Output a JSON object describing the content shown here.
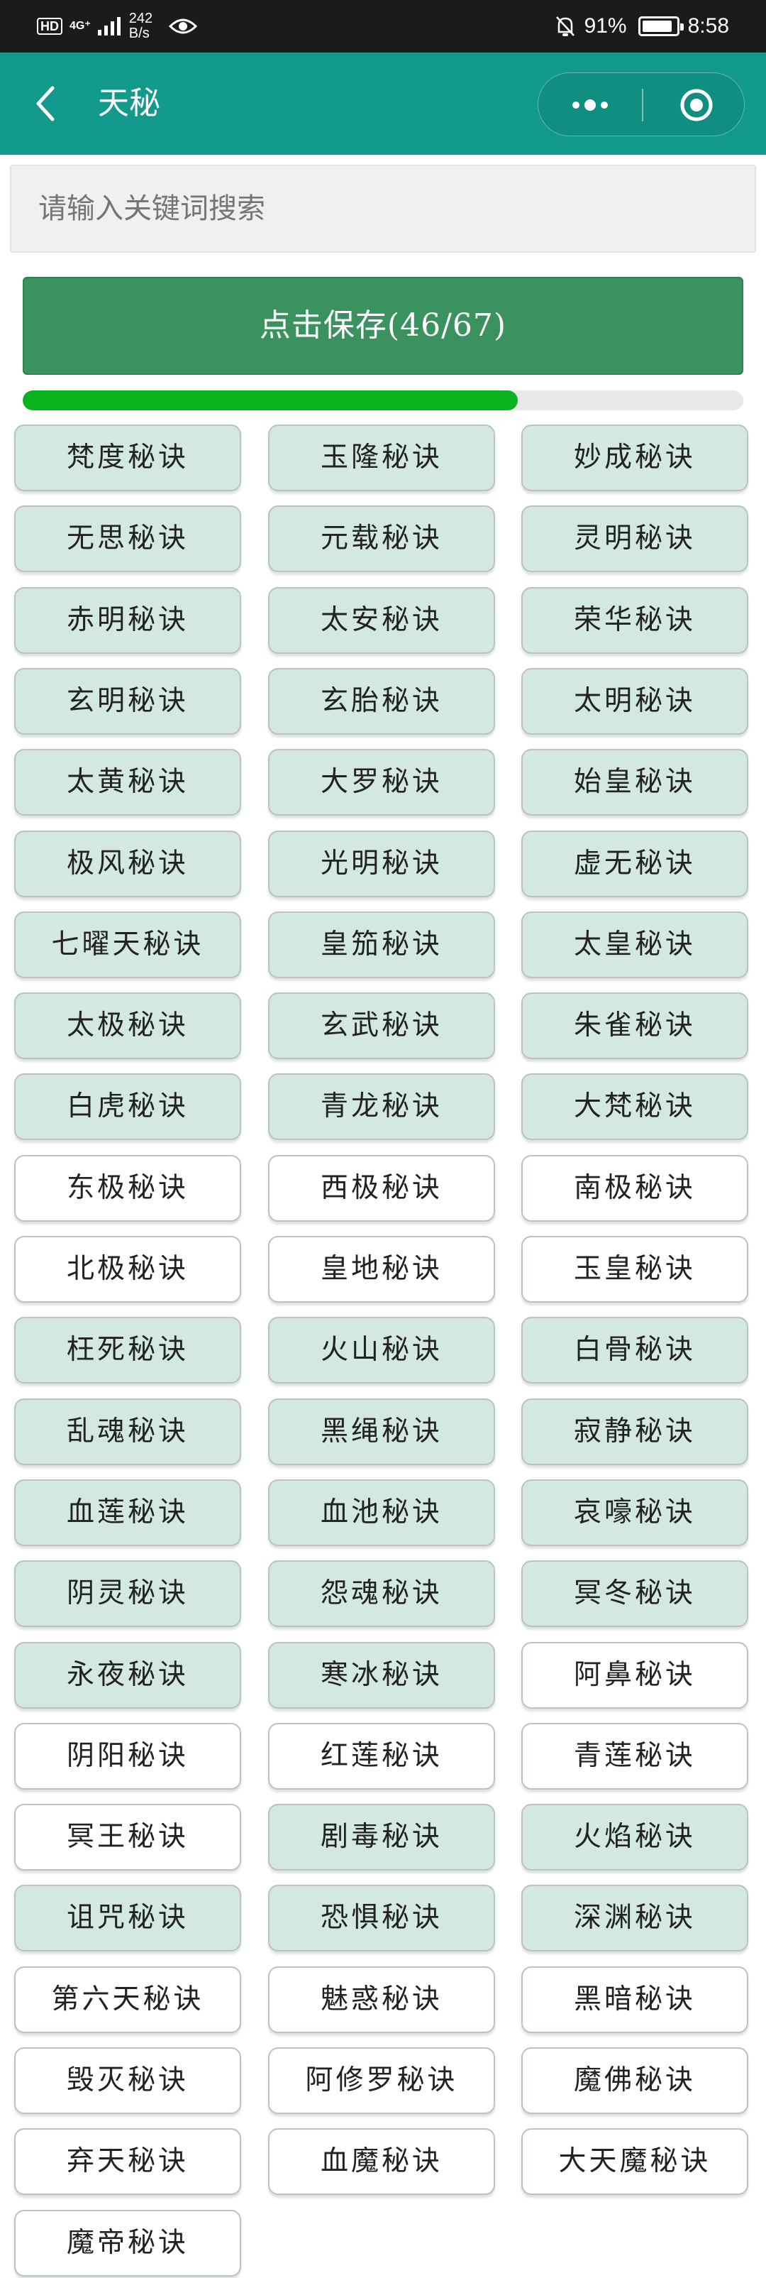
{
  "status_bar": {
    "hd": "HD",
    "network": "4G⁺",
    "speed_value": "242",
    "speed_unit": "B/s",
    "battery_text": "91%",
    "battery_level": 0.91,
    "time": "8:58"
  },
  "nav": {
    "title": "天秘",
    "back_icon": "chevron-left-icon",
    "more_icon": "more-dots-icon",
    "close_icon": "mini-program-close-icon"
  },
  "search": {
    "placeholder": "请输入关键词搜索",
    "value": ""
  },
  "save_button": {
    "label": "点击保存(46/67)"
  },
  "progress": {
    "saved": 46,
    "total": 67,
    "fraction": 0.6866
  },
  "colors": {
    "nav_bg": "#129b8d",
    "save_bg": "#3a925e",
    "progress_fill": "#09b31d",
    "saved_item_bg": "#d3e8df",
    "unsaved_item_bg": "#ffffff"
  },
  "items": [
    {
      "label": "梵度秘诀",
      "saved": true
    },
    {
      "label": "玉隆秘诀",
      "saved": true
    },
    {
      "label": "妙成秘诀",
      "saved": true
    },
    {
      "label": "无思秘诀",
      "saved": true
    },
    {
      "label": "元载秘诀",
      "saved": true
    },
    {
      "label": "灵明秘诀",
      "saved": true
    },
    {
      "label": "赤明秘诀",
      "saved": true
    },
    {
      "label": "太安秘诀",
      "saved": true
    },
    {
      "label": "荣华秘诀",
      "saved": true
    },
    {
      "label": "玄明秘诀",
      "saved": true
    },
    {
      "label": "玄胎秘诀",
      "saved": true
    },
    {
      "label": "太明秘诀",
      "saved": true
    },
    {
      "label": "太黄秘诀",
      "saved": true
    },
    {
      "label": "大罗秘诀",
      "saved": true
    },
    {
      "label": "始皇秘诀",
      "saved": true
    },
    {
      "label": "极风秘诀",
      "saved": true
    },
    {
      "label": "光明秘诀",
      "saved": true
    },
    {
      "label": "虚无秘诀",
      "saved": true
    },
    {
      "label": "七曜天秘诀",
      "saved": true
    },
    {
      "label": "皇笳秘诀",
      "saved": true
    },
    {
      "label": "太皇秘诀",
      "saved": true
    },
    {
      "label": "太极秘诀",
      "saved": true
    },
    {
      "label": "玄武秘诀",
      "saved": true
    },
    {
      "label": "朱雀秘诀",
      "saved": true
    },
    {
      "label": "白虎秘诀",
      "saved": true
    },
    {
      "label": "青龙秘诀",
      "saved": true
    },
    {
      "label": "大梵秘诀",
      "saved": true
    },
    {
      "label": "东极秘诀",
      "saved": false
    },
    {
      "label": "西极秘诀",
      "saved": false
    },
    {
      "label": "南极秘诀",
      "saved": false
    },
    {
      "label": "北极秘诀",
      "saved": false
    },
    {
      "label": "皇地秘诀",
      "saved": false
    },
    {
      "label": "玉皇秘诀",
      "saved": false
    },
    {
      "label": "枉死秘诀",
      "saved": true
    },
    {
      "label": "火山秘诀",
      "saved": true
    },
    {
      "label": "白骨秘诀",
      "saved": true
    },
    {
      "label": "乱魂秘诀",
      "saved": true
    },
    {
      "label": "黑绳秘诀",
      "saved": true
    },
    {
      "label": "寂静秘诀",
      "saved": true
    },
    {
      "label": "血莲秘诀",
      "saved": true
    },
    {
      "label": "血池秘诀",
      "saved": true
    },
    {
      "label": "哀嚎秘诀",
      "saved": true
    },
    {
      "label": "阴灵秘诀",
      "saved": true
    },
    {
      "label": "怨魂秘诀",
      "saved": true
    },
    {
      "label": "冥冬秘诀",
      "saved": true
    },
    {
      "label": "永夜秘诀",
      "saved": true
    },
    {
      "label": "寒冰秘诀",
      "saved": true
    },
    {
      "label": "阿鼻秘诀",
      "saved": false
    },
    {
      "label": "阴阳秘诀",
      "saved": false
    },
    {
      "label": "红莲秘诀",
      "saved": false
    },
    {
      "label": "青莲秘诀",
      "saved": false
    },
    {
      "label": "冥王秘诀",
      "saved": false
    },
    {
      "label": "剧毒秘诀",
      "saved": true
    },
    {
      "label": "火焰秘诀",
      "saved": true
    },
    {
      "label": "诅咒秘诀",
      "saved": true
    },
    {
      "label": "恐惧秘诀",
      "saved": true
    },
    {
      "label": "深渊秘诀",
      "saved": true
    },
    {
      "label": "第六天秘诀",
      "saved": false
    },
    {
      "label": "魅惑秘诀",
      "saved": false
    },
    {
      "label": "黑暗秘诀",
      "saved": false
    },
    {
      "label": "毁灭秘诀",
      "saved": false
    },
    {
      "label": "阿修罗秘诀",
      "saved": false
    },
    {
      "label": "魔佛秘诀",
      "saved": false
    },
    {
      "label": "弃天秘诀",
      "saved": false
    },
    {
      "label": "血魔秘诀",
      "saved": false
    },
    {
      "label": "大天魔秘诀",
      "saved": false
    },
    {
      "label": "魔帝秘诀",
      "saved": false
    }
  ]
}
